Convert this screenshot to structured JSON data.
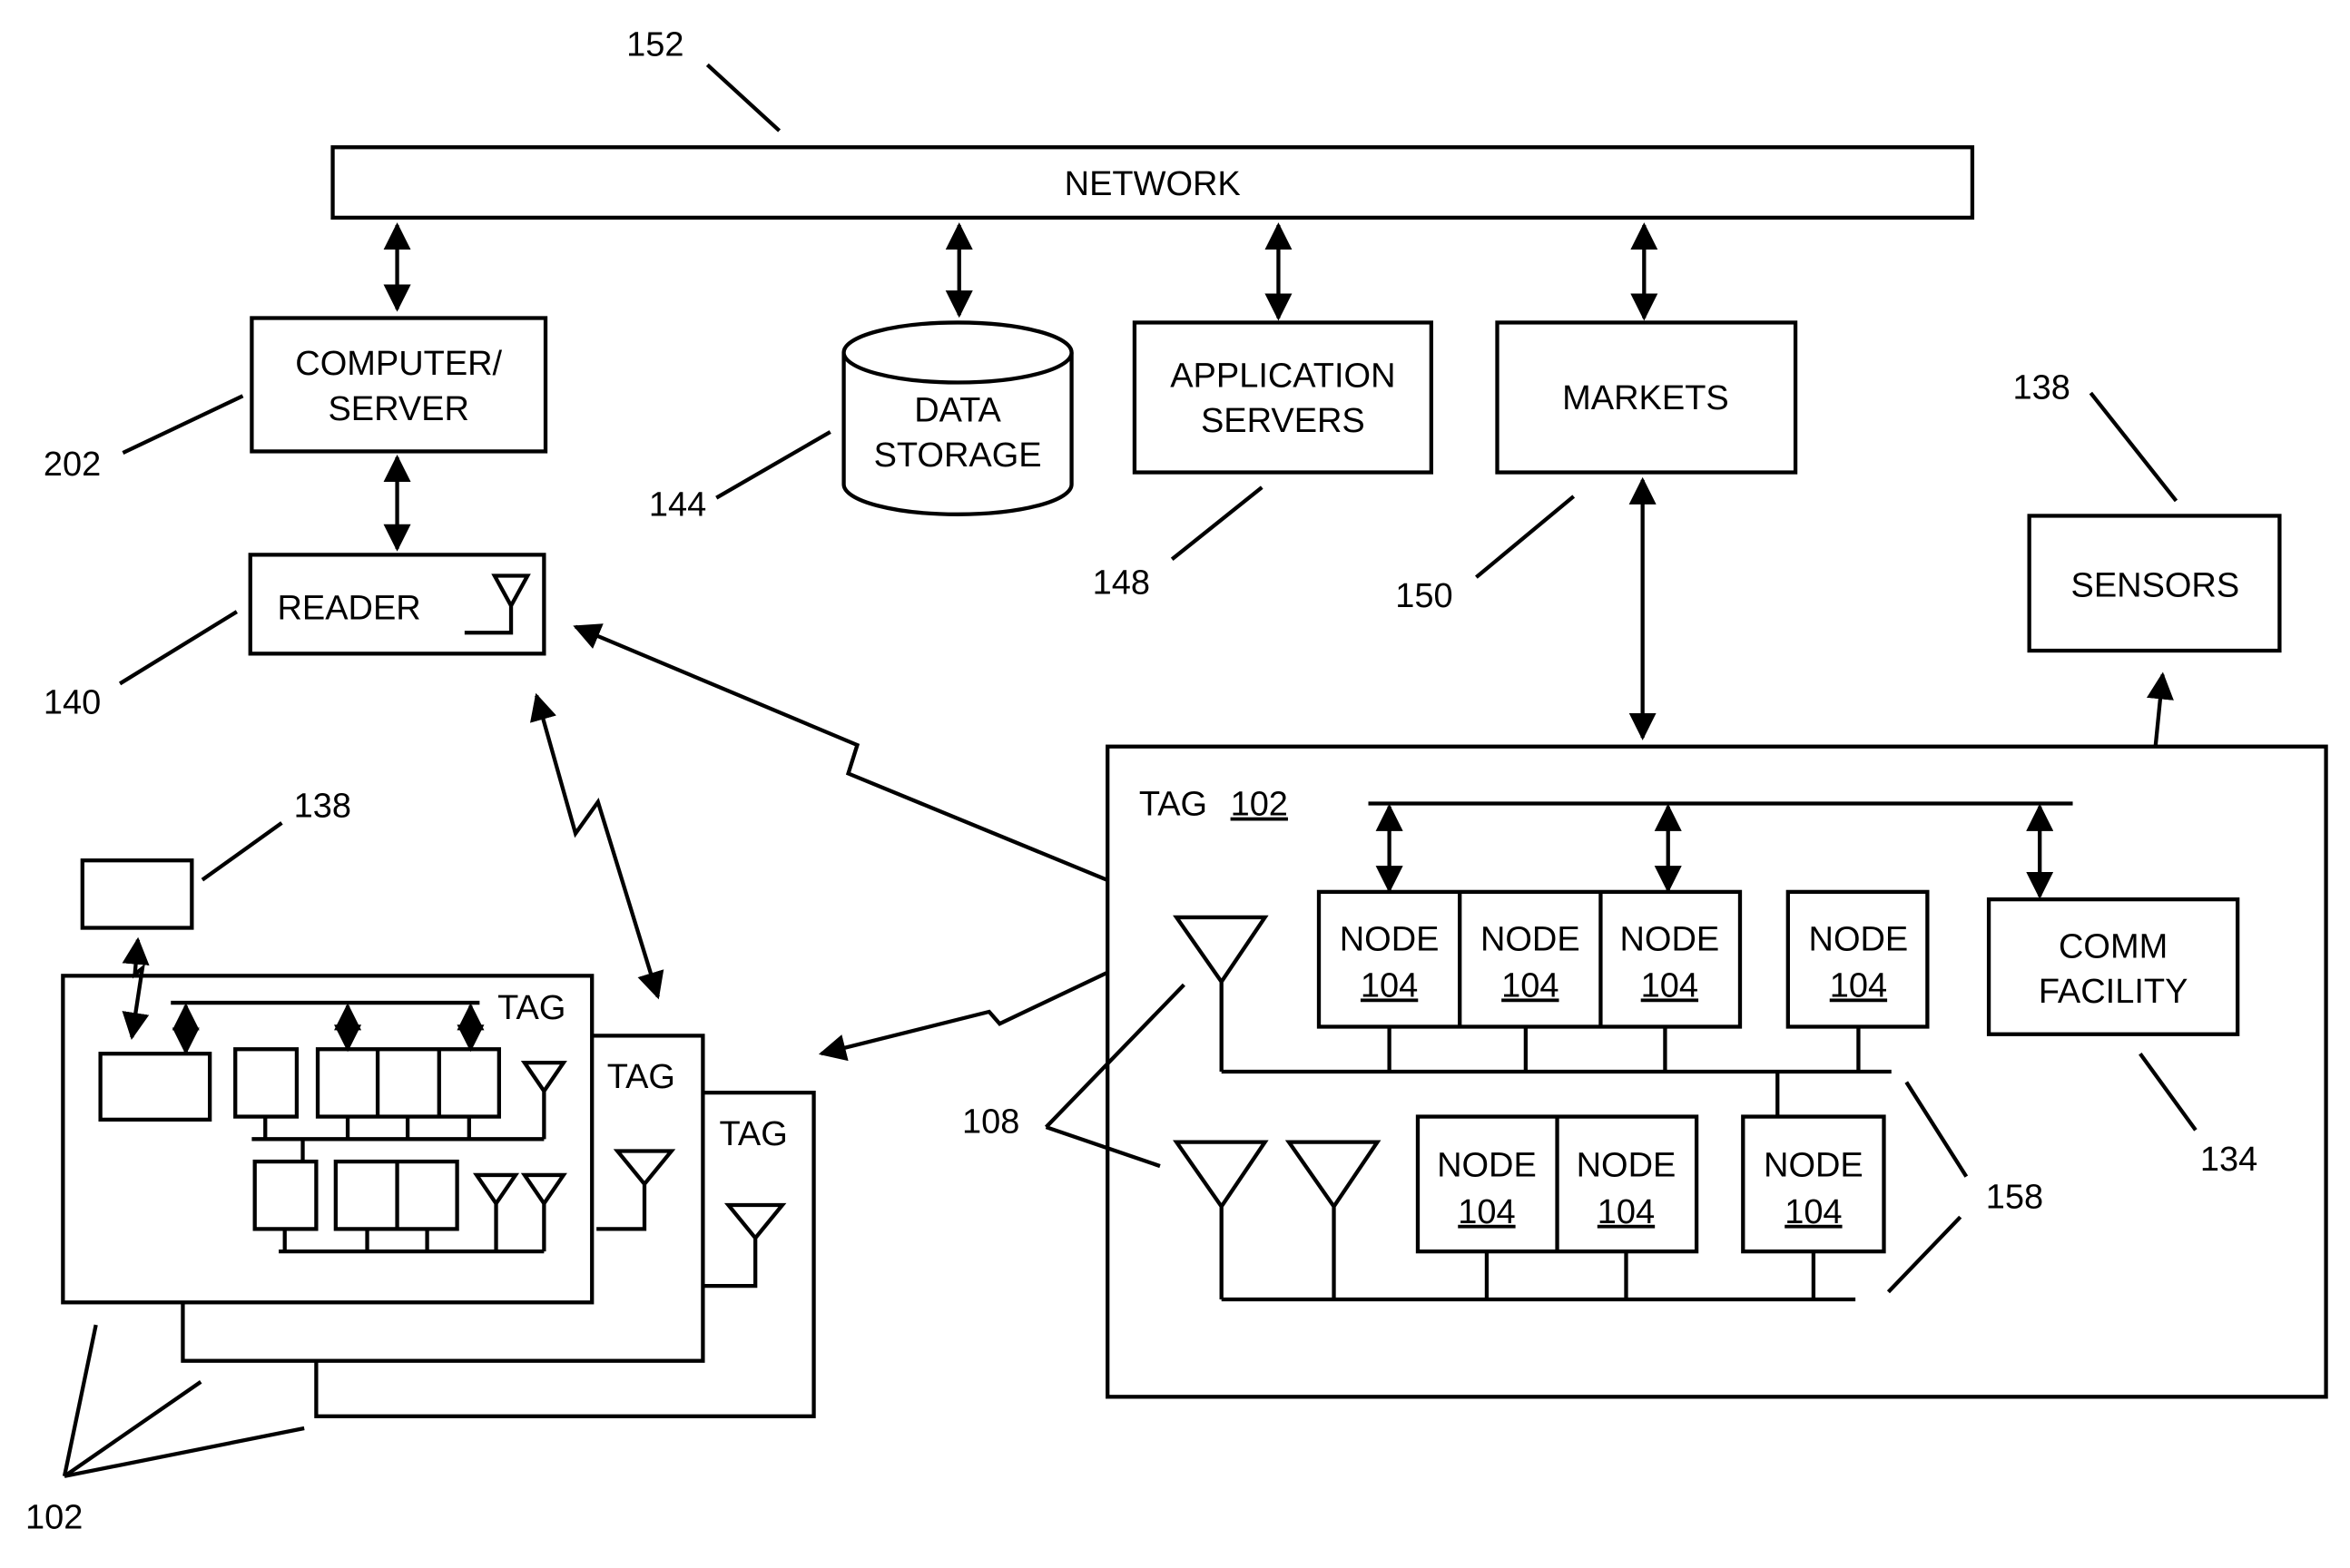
{
  "diagram": {
    "network": {
      "label": "NETWORK",
      "ref": "152"
    },
    "computer_server": {
      "line1": "COMPUTER/",
      "line2": "SERVER",
      "ref": "202"
    },
    "data_storage": {
      "line1": "DATA",
      "line2": "STORAGE",
      "ref": "144"
    },
    "application_servers": {
      "line1": "APPLICATION",
      "line2": "SERVERS",
      "ref": "148"
    },
    "markets": {
      "label": "MARKETS",
      "ref": "150"
    },
    "sensors": {
      "label": "SENSORS",
      "ref": "138"
    },
    "reader": {
      "label": "READER",
      "ref": "140"
    },
    "small_sensor": {
      "ref": "138"
    },
    "tag_stack": {
      "tags": [
        "TAG",
        "TAG",
        "TAG"
      ],
      "ref": "102"
    },
    "tag_detail": {
      "label": "TAG",
      "ref_underlined": "102"
    },
    "node": {
      "label": "NODE",
      "ref": "104"
    },
    "comm_facility": {
      "line1": "COMM",
      "line2": "FACILITY",
      "ref": "134"
    },
    "antenna_ref": "108",
    "bus_ref": "158"
  }
}
